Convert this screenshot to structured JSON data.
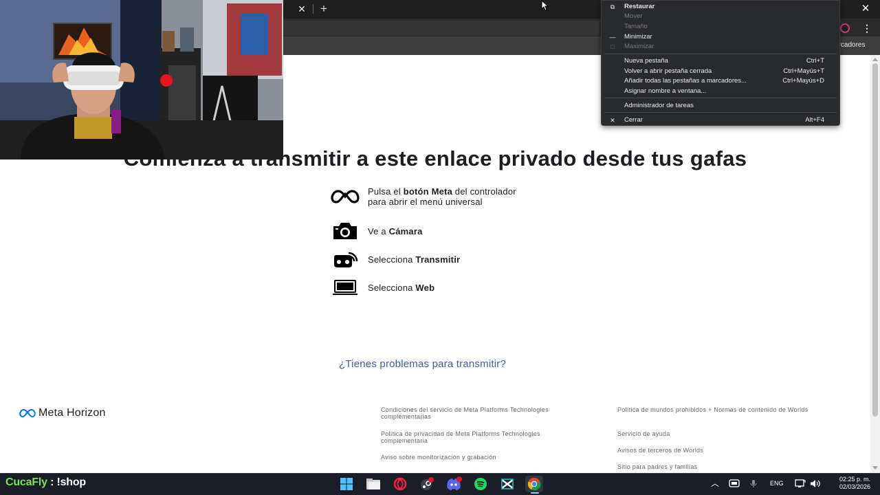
{
  "browser": {
    "bookmarks_label": "arcadores"
  },
  "page": {
    "title": "Comienza a transmitir a este enlace privado desde tus gafas",
    "steps": [
      {
        "icon": "meta-logo-icon",
        "before": "Pulsa el ",
        "bold": "botón Meta",
        "after": " del controlador",
        "line2": "para abrir el menú universal"
      },
      {
        "icon": "camera-icon",
        "before": "Ve a ",
        "bold": "Cámara",
        "after": "",
        "line2": ""
      },
      {
        "icon": "cast-icon",
        "before": "Selecciona ",
        "bold": "Transmitir",
        "after": "",
        "line2": ""
      },
      {
        "icon": "laptop-icon",
        "before": "Selecciona ",
        "bold": "Web",
        "after": "",
        "line2": ""
      }
    ],
    "help_link": "¿Tienes problemas para transmitir?",
    "footer": {
      "logo_text": "Meta Horizon",
      "col1": [
        "Condiciones del servicio de Meta Platforms Technologies complementarias",
        "Política de privacidad de Meta Platforms Technologies complementaria",
        "Aviso sobre monitorización y grabación"
      ],
      "col2": [
        "Política de mundos prohibidos + Normas de contenido de Worlds",
        "Servicio de ayuda",
        "Avisos de terceros de Worlds",
        "Sitio para padres y familias"
      ]
    }
  },
  "context_menu": {
    "items": [
      {
        "label": "Restaurar",
        "shortcut": "",
        "icon": "restore-icon",
        "enabled": true
      },
      {
        "label": "Mover",
        "shortcut": "",
        "icon": "",
        "enabled": false
      },
      {
        "label": "Tamaño",
        "shortcut": "",
        "icon": "",
        "enabled": false
      },
      {
        "label": "Minimizar",
        "shortcut": "",
        "icon": "minimize-icon",
        "enabled": true
      },
      {
        "label": "Maximizar",
        "shortcut": "",
        "icon": "maximize-icon",
        "enabled": false
      },
      {
        "label": "Nueva pestaña",
        "shortcut": "Ctrl+T",
        "icon": "",
        "enabled": true
      },
      {
        "label": "Volver a abrir pestaña cerrada",
        "shortcut": "Ctrl+Mayús+T",
        "icon": "",
        "enabled": true
      },
      {
        "label": "Añadir todas las pestañas a marcadores...",
        "shortcut": "Ctrl+Mayús+D",
        "icon": "",
        "enabled": true
      },
      {
        "label": "Asignar nombre a ventana...",
        "shortcut": "",
        "icon": "",
        "enabled": true
      },
      {
        "label": "Administrador de tareas",
        "shortcut": "",
        "icon": "",
        "enabled": true
      },
      {
        "label": "Cerrar",
        "shortcut": "Alt+F4",
        "icon": "close-icon",
        "enabled": true
      }
    ]
  },
  "taskbar": {
    "stream_user": "CucaFly",
    "stream_command": " : !shop",
    "language": "ENG",
    "time": "02:25 p. m.",
    "date": "02/03/2026"
  }
}
